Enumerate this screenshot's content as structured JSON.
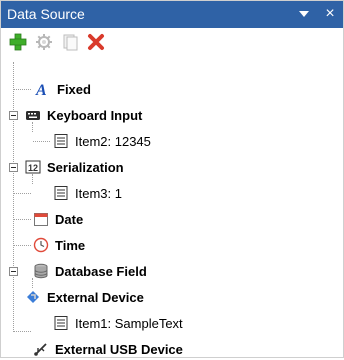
{
  "panel": {
    "title": "Data Source",
    "pin_icon": "chevron-down-icon",
    "close_label": "×"
  },
  "toolbar": {
    "buttons": [
      {
        "name": "add-button",
        "icon": "plus-icon",
        "color": "#3fae2a",
        "enabled": true
      },
      {
        "name": "properties-button",
        "icon": "gear-icon",
        "color": "#9b9b9b",
        "enabled": false
      },
      {
        "name": "copy-button",
        "icon": "copy-icon",
        "color": "#9b9b9b",
        "enabled": false
      },
      {
        "name": "delete-button",
        "icon": "delete-x-icon",
        "color": "#d93a2b",
        "enabled": true
      }
    ]
  },
  "tree": {
    "items": [
      {
        "label": "Fixed",
        "icon": "letter-a-icon"
      },
      {
        "label": "Keyboard Input",
        "icon": "keyboard-icon"
      },
      {
        "label": "Item2: 12345",
        "icon": "item-icon"
      },
      {
        "label": "Serialization",
        "icon": "serialization-icon"
      },
      {
        "label": "Item3: 1",
        "icon": "item-icon"
      },
      {
        "label": "Date",
        "icon": "calendar-icon"
      },
      {
        "label": "Time",
        "icon": "clock-icon"
      },
      {
        "label": "Database Field",
        "icon": "database-icon"
      },
      {
        "label": "External Device",
        "icon": "external-device-icon"
      },
      {
        "label": "Item1: SampleText",
        "icon": "item-icon"
      },
      {
        "label": "External USB Device",
        "icon": "usb-icon"
      }
    ]
  }
}
